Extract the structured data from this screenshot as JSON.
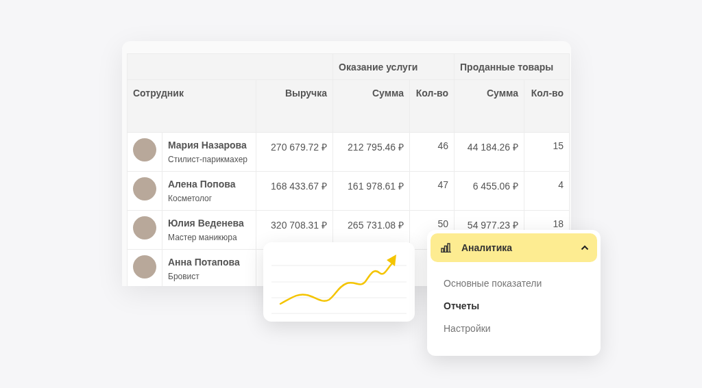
{
  "table": {
    "group_headers": [
      "Оказание услуги",
      "Проданные товары"
    ],
    "columns": [
      "Сотрудник",
      "Выручка",
      "Сумма",
      "Кол-во",
      "Сумма",
      "Кол-во"
    ],
    "rows": [
      {
        "name": "Мария Назарова",
        "role": "Стилист-парикмахер",
        "values": [
          "270 679.72 ₽",
          "212 795.46 ₽",
          "46",
          "44 184.26 ₽",
          "15"
        ]
      },
      {
        "name": "Алена Попова",
        "role": "Косметолог",
        "values": [
          "168 433.67 ₽",
          "161 978.61 ₽",
          "47",
          "6 455.06 ₽",
          "4"
        ]
      },
      {
        "name": "Юлия Веденева",
        "role": "Мастер маникюра",
        "values": [
          "320 708.31 ₽",
          "265 731.08 ₽",
          "50",
          "54 977.23 ₽",
          "18"
        ]
      },
      {
        "name": "Анна Потапова",
        "role": "Бровист"
      }
    ]
  },
  "menu": {
    "title": "Аналитика",
    "expanded": true,
    "items": [
      {
        "label": "Основные показатели",
        "selected": false
      },
      {
        "label": "Отчеты",
        "selected": true
      },
      {
        "label": "Настройки",
        "selected": false
      }
    ]
  }
}
